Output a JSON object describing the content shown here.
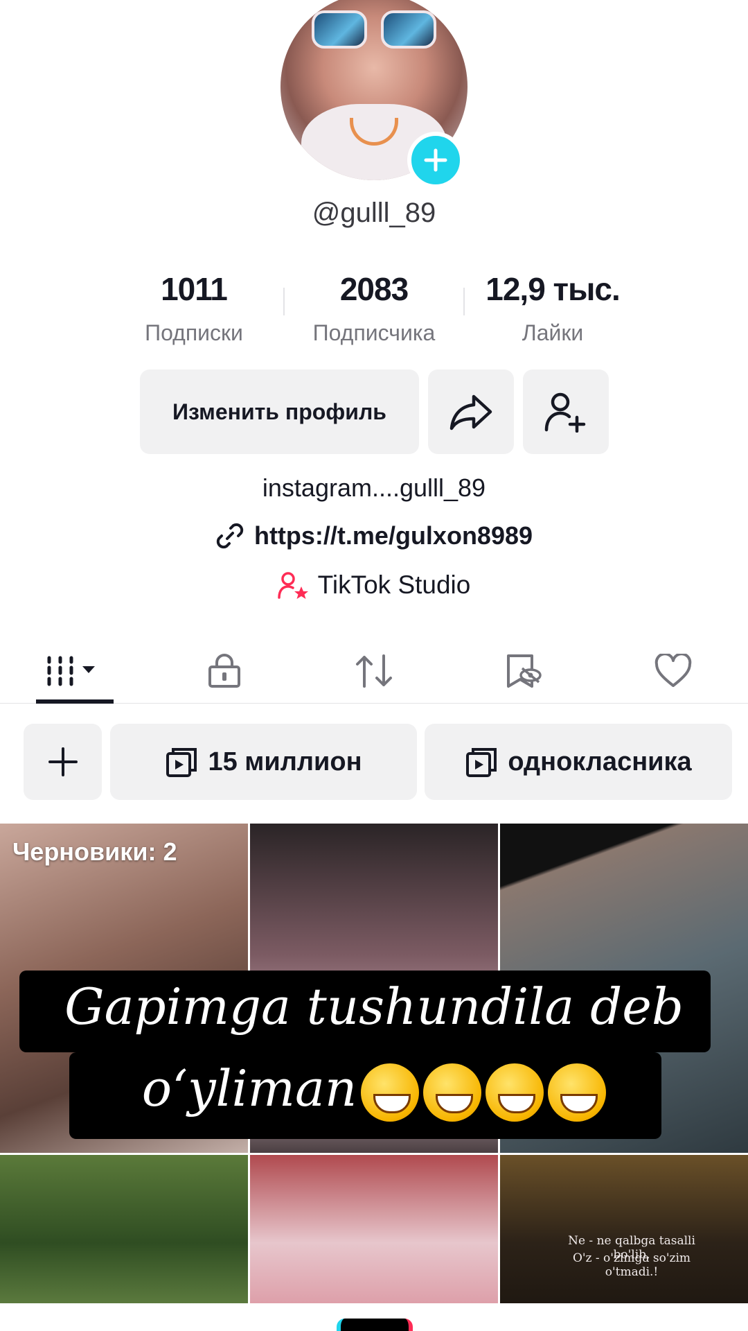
{
  "profile": {
    "username": "@gulll_89",
    "stats": [
      {
        "value": "1011",
        "label": "Подписки"
      },
      {
        "value": "2083",
        "label": "Подписчика"
      },
      {
        "value": "12,9 тыс.",
        "label": "Лайки"
      }
    ],
    "edit_profile_label": "Изменить профиль",
    "bio": "instagram....gulll_89",
    "link": "https://t.me/gulxon8989",
    "studio_label": "TikTok Studio"
  },
  "tabs": [
    {
      "icon": "grid-icon",
      "active": true
    },
    {
      "icon": "lock-icon"
    },
    {
      "icon": "repost-icon"
    },
    {
      "icon": "bookmark-hidden-icon"
    },
    {
      "icon": "heart-icon"
    }
  ],
  "playlists": [
    {
      "label": "15 миллион",
      "icon": "playlist-icon"
    },
    {
      "label": "однокласника",
      "icon": "playlist-icon"
    }
  ],
  "grid": {
    "drafts_label": "Черновики: 2",
    "cell6_text_1": "Ne - ne qalbga tasalli bo'lib,",
    "cell6_text_2": "O'z - o'zimga so'zim o'tmadi.!"
  },
  "caption": {
    "line1": "Gapimga tushundila deb",
    "line2": "o‘yliman"
  },
  "colors": {
    "accent_cyan": "#20d5ec",
    "accent_pink": "#fe2c55",
    "chip_bg": "#f1f1f2"
  }
}
